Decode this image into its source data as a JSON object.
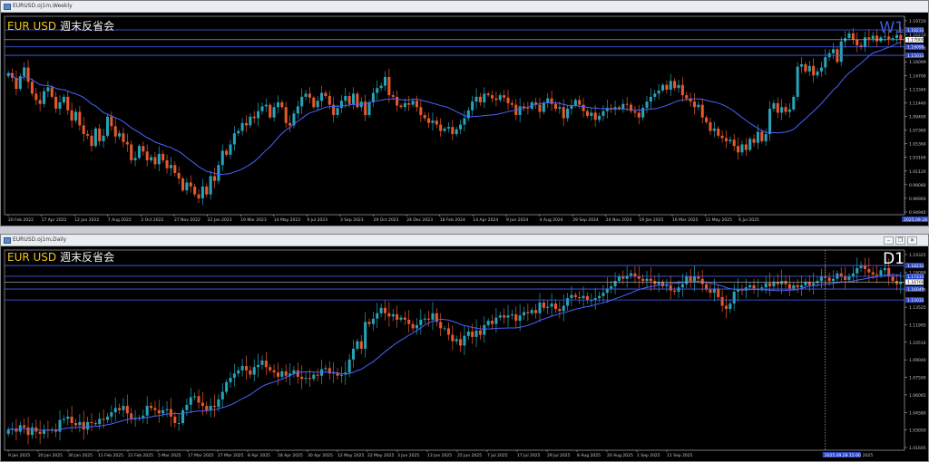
{
  "colors": {
    "bull": "#26a3b8",
    "bear": "#e8582a",
    "ma": "#4a63ff",
    "level_line": "#4a63ff",
    "price_line": "#bdbdbd",
    "axis_text": "#c8c8c8",
    "grid_frame": "#c8c8c8",
    "header_pair": "#f2c318",
    "header_text": "#f2f2f2"
  },
  "panels": [
    {
      "window_title": "EURUSD.oj1m,Weekly",
      "header_pair": "EUR USD",
      "header_text": "週末反省会",
      "timeframe": "W1",
      "price_labels": [
        "1.19720",
        "1.16233",
        "1.17680",
        "1.16099",
        "1.14700",
        "1.13340",
        "1.11440",
        "1.09400",
        "1.07360",
        "1.05360",
        "1.03160",
        "1.01120",
        "0.99080",
        "0.96960",
        "0.94940"
      ],
      "highlight_labels": [
        "1.18233",
        "1.16099",
        "1.15033"
      ],
      "date_labels": [
        "20 Feb 2022",
        "17 Apr 2022",
        "12 Jun 2022",
        "7 Aug 2022",
        "2 Oct 2022",
        "27 Nov 2022",
        "22 Jan 2023",
        "19 Mar 2023",
        "14 May 2023",
        "9 Jul 2023",
        "3 Sep 2023",
        "29 Oct 2023",
        "24 Dec 2023",
        "18 Feb 2024",
        "14 Apr 2024",
        "9 Jun 2024",
        "4 Aug 2024",
        "29 Sep 2024",
        "24 Nov 2024",
        "19 Jan 2025",
        "16 Mar 2025",
        "11 May 2025",
        "6 Jul 2025"
      ],
      "cursor_label": "2025.09.28 10:00"
    },
    {
      "window_title": "EURUSD.oj1m,Daily",
      "header_pair": "EUR USD",
      "header_text": "週末反省会",
      "timeframe": "D1",
      "price_labels": [
        "1.19325",
        "1.16099",
        "1.15015",
        "1.13525",
        "1.11995",
        "1.10510",
        "1.09040",
        "1.07590",
        "1.06065",
        "1.04580",
        "1.03050",
        "1.01605"
      ],
      "highlight_labels": [
        "1.18233",
        "1.17233",
        "1.16049",
        "1.15033"
      ],
      "date_labels": [
        "9 Jan 2025",
        "20 Jan 2025",
        "30 Jan 2025",
        "11 Feb 2025",
        "21 Feb 2025",
        "5 Mar 2025",
        "17 Mar 2025",
        "27 Mar 2025",
        "8 Apr 2025",
        "18 Apr 2025",
        "30 Apr 2025",
        "12 May 2025",
        "22 May 2025",
        "3 Jun 2025",
        "13 Jun 2025",
        "25 Jun 2025",
        "7 Jul 2025",
        "17 Jul 2025",
        "29 Jul 2025",
        "8 Aug 2025",
        "20 Aug 2025",
        "1 Sep 2025",
        "11 Sep 2025"
      ],
      "cursor_label": "2025.09.28 15:00",
      "date_label_tail": "2025"
    }
  ],
  "chart_data": [
    {
      "type": "candlestick",
      "title": "EURUSD.oj1m,Weekly",
      "timeframe": "W1",
      "ylim": [
        0.9494,
        1.1995
      ],
      "levels": [
        1.18233,
        1.16099,
        1.15033
      ],
      "close": [
        1.128,
        1.122,
        1.108,
        1.124,
        1.135,
        1.117,
        1.102,
        1.094,
        1.089,
        1.105,
        1.11,
        1.098,
        1.083,
        1.091,
        1.098,
        1.081,
        1.068,
        1.079,
        1.062,
        1.051,
        1.049,
        1.036,
        1.058,
        1.042,
        1.049,
        1.073,
        1.061,
        1.048,
        1.052,
        1.041,
        1.038,
        1.018,
        1.021,
        1.036,
        1.029,
        1.018,
        1.022,
        1.013,
        1.026,
        1.018,
        1.008,
        1.012,
        1.002,
        0.995,
        0.98,
        0.99,
        0.985,
        0.975,
        0.97,
        0.985,
        0.975,
        0.998,
        0.992,
        1.012,
        1.03,
        1.025,
        1.038,
        1.052,
        1.055,
        1.065,
        1.062,
        1.073,
        1.071,
        1.08,
        1.086,
        1.088,
        1.072,
        1.085,
        1.091,
        1.085,
        1.065,
        1.062,
        1.077,
        1.086,
        1.098,
        1.102,
        1.097,
        1.085,
        1.093,
        1.103,
        1.099,
        1.088,
        1.075,
        1.084,
        1.093,
        1.099,
        1.089,
        1.102,
        1.085,
        1.092,
        1.075,
        1.091,
        1.103,
        1.109,
        1.112,
        1.123,
        1.1,
        1.098,
        1.087,
        1.085,
        1.09,
        1.088,
        1.093,
        1.085,
        1.075,
        1.071,
        1.065,
        1.068,
        1.063,
        1.055,
        1.058,
        1.06,
        1.051,
        1.057,
        1.063,
        1.071,
        1.081,
        1.092,
        1.098,
        1.091,
        1.102,
        1.1,
        1.096,
        1.094,
        1.1,
        1.097,
        1.09,
        1.088,
        1.075,
        1.086,
        1.084,
        1.083,
        1.091,
        1.088,
        1.079,
        1.09,
        1.096,
        1.089,
        1.083,
        1.085,
        1.071,
        1.083,
        1.087,
        1.094,
        1.088,
        1.08,
        1.074,
        1.078,
        1.069,
        1.074,
        1.08,
        1.084,
        1.082,
        1.085,
        1.083,
        1.089,
        1.088,
        1.08,
        1.078,
        1.072,
        1.084,
        1.092,
        1.098,
        1.102,
        1.106,
        1.113,
        1.107,
        1.118,
        1.109,
        1.113,
        1.1,
        1.096,
        1.092,
        1.085,
        1.088,
        1.072,
        1.066,
        1.055,
        1.058,
        1.049,
        1.046,
        1.042,
        1.044,
        1.036,
        1.028,
        1.038,
        1.031,
        1.045,
        1.04,
        1.054,
        1.042,
        1.051,
        1.083,
        1.09,
        1.078,
        1.085,
        1.079,
        1.082,
        1.098,
        1.136,
        1.139,
        1.13,
        1.137,
        1.125,
        1.13,
        1.135,
        1.148,
        1.153,
        1.158,
        1.142,
        1.168,
        1.172,
        1.178,
        1.17,
        1.163,
        1.161,
        1.173,
        1.171,
        1.175,
        1.168,
        1.173,
        1.174,
        1.171,
        1.172,
        1.176,
        1.17
      ]
    },
    {
      "type": "candlestick",
      "title": "EURUSD.oj1m,Daily",
      "timeframe": "D1",
      "ylim": [
        1.0108,
        1.1967
      ],
      "levels": [
        1.18233,
        1.17233,
        1.16049,
        1.15033
      ],
      "close": [
        1.03,
        1.031,
        1.028,
        1.034,
        1.032,
        1.025,
        1.032,
        1.028,
        1.026,
        1.03,
        1.029,
        1.03,
        1.028,
        1.039,
        1.04,
        1.042,
        1.036,
        1.034,
        1.037,
        1.03,
        1.037,
        1.036,
        1.035,
        1.04,
        1.039,
        1.042,
        1.046,
        1.05,
        1.048,
        1.052,
        1.045,
        1.04,
        1.04,
        1.041,
        1.043,
        1.052,
        1.05,
        1.048,
        1.045,
        1.048,
        1.049,
        1.042,
        1.036,
        1.036,
        1.048,
        1.053,
        1.06,
        1.061,
        1.055,
        1.052,
        1.048,
        1.052,
        1.051,
        1.058,
        1.065,
        1.074,
        1.078,
        1.082,
        1.085,
        1.089,
        1.085,
        1.081,
        1.088,
        1.09,
        1.094,
        1.088,
        1.085,
        1.083,
        1.079,
        1.084,
        1.08,
        1.082,
        1.085,
        1.079,
        1.077,
        1.078,
        1.077,
        1.081,
        1.08,
        1.086,
        1.087,
        1.082,
        1.083,
        1.08,
        1.081,
        1.083,
        1.095,
        1.105,
        1.112,
        1.105,
        1.13,
        1.128,
        1.133,
        1.138,
        1.143,
        1.138,
        1.135,
        1.137,
        1.132,
        1.134,
        1.132,
        1.128,
        1.124,
        1.127,
        1.132,
        1.133,
        1.132,
        1.138,
        1.13,
        1.124,
        1.124,
        1.118,
        1.112,
        1.114,
        1.108,
        1.117,
        1.121,
        1.116,
        1.122,
        1.118,
        1.127,
        1.131,
        1.128,
        1.134,
        1.136,
        1.134,
        1.136,
        1.137,
        1.131,
        1.136,
        1.139,
        1.138,
        1.141,
        1.138,
        1.148,
        1.143,
        1.144,
        1.147,
        1.142,
        1.14,
        1.145,
        1.152,
        1.155,
        1.153,
        1.152,
        1.154,
        1.15,
        1.15,
        1.152,
        1.154,
        1.157,
        1.161,
        1.163,
        1.168,
        1.172,
        1.17,
        1.173,
        1.175,
        1.172,
        1.17,
        1.168,
        1.17,
        1.168,
        1.165,
        1.167,
        1.163,
        1.164,
        1.159,
        1.158,
        1.162,
        1.165,
        1.172,
        1.168,
        1.172,
        1.17,
        1.165,
        1.16,
        1.157,
        1.161,
        1.153,
        1.145,
        1.142,
        1.147,
        1.158,
        1.16,
        1.159,
        1.162,
        1.164,
        1.161,
        1.161,
        1.162,
        1.166,
        1.163,
        1.167,
        1.165,
        1.168,
        1.165,
        1.161,
        1.164,
        1.162,
        1.164,
        1.167,
        1.164,
        1.166,
        1.168,
        1.172,
        1.171,
        1.168,
        1.17,
        1.175,
        1.172,
        1.169,
        1.172,
        1.175,
        1.18,
        1.182,
        1.179,
        1.176,
        1.174,
        1.173,
        1.178,
        1.18,
        1.172,
        1.168,
        1.165,
        1.167
      ]
    }
  ]
}
